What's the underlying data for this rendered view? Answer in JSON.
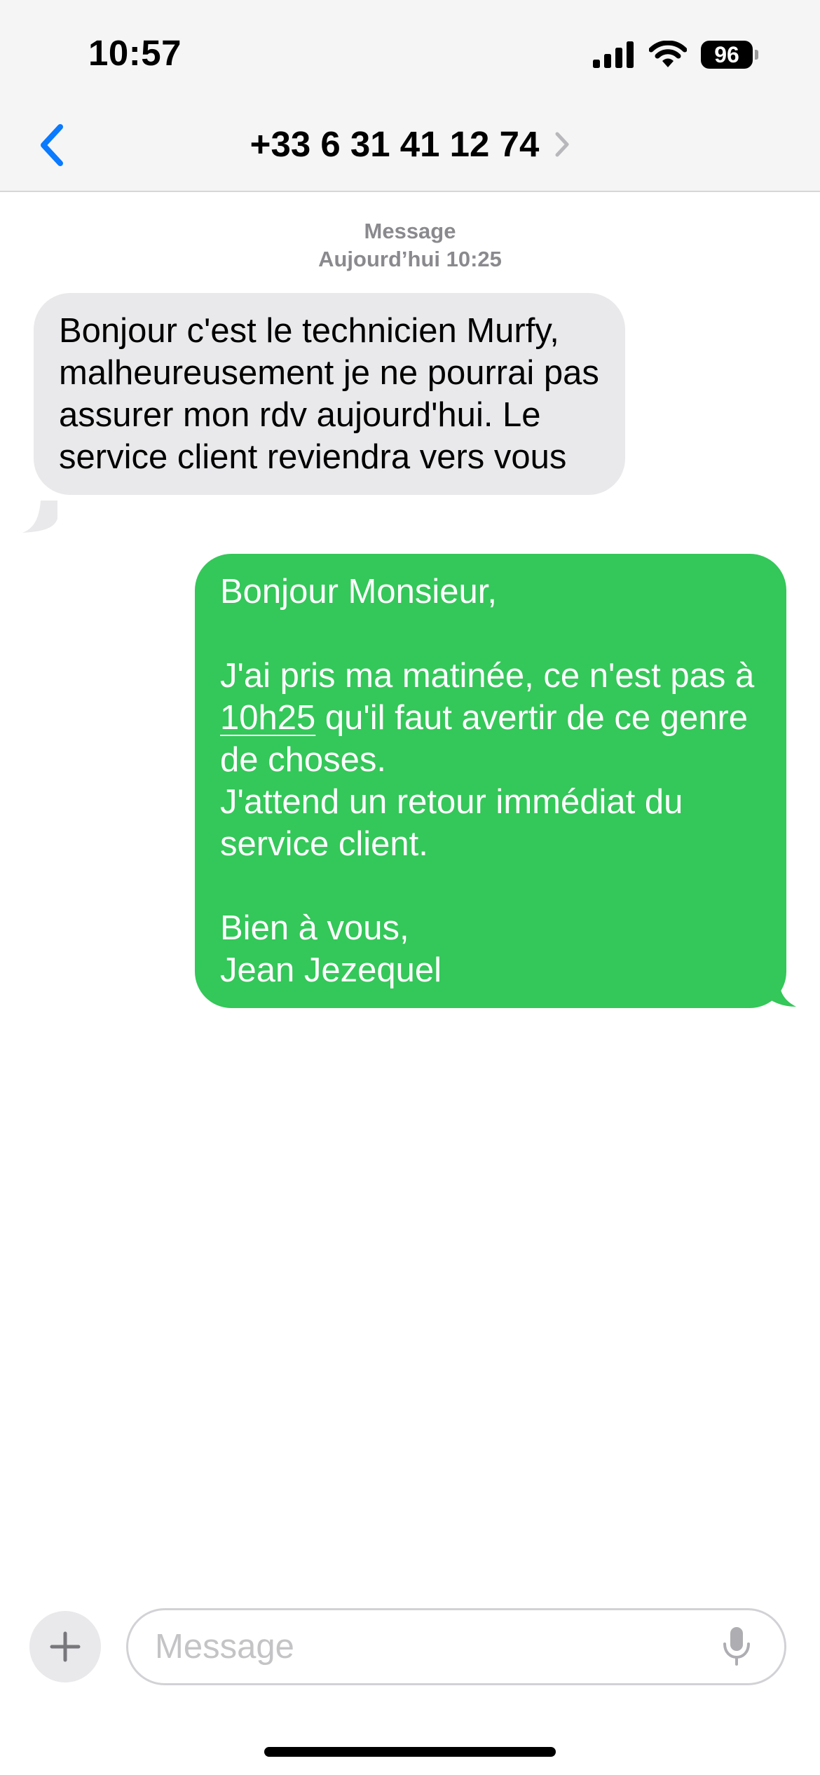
{
  "status_bar": {
    "time": "10:57",
    "battery": "96",
    "icons": [
      "cellular-signal-icon",
      "wifi-icon",
      "battery-icon"
    ]
  },
  "nav": {
    "back_icon": "chevron-left-icon",
    "contact": "+33 6 31 41 12 74",
    "details_icon": "chevron-right-icon"
  },
  "conversation": {
    "service": "Message",
    "timestamp": "Aujourd’hui 10:25",
    "incoming": {
      "text": "Bonjour c'est le technicien Murfy, malheureusement je ne pourrai pas assurer mon rdv aujourd'hui. Le service client reviendra vers vous"
    },
    "outgoing": {
      "part1": "Bonjour Monsieur,\n\nJ'ai pris ma matinée, ce n'est pas à ",
      "link": "10h25",
      "part2": " qu'il faut avertir de ce genre de choses.\nJ'attend un retour immédiat du service client.\n\nBien à vous,\nJean Jezequel"
    }
  },
  "composer": {
    "plus_icon": "plus-icon",
    "placeholder": "Message",
    "value": "",
    "mic_icon": "microphone-icon"
  },
  "colors": {
    "accent_blue": "#0a7aff",
    "outgoing_bubble": "#34c759",
    "incoming_bubble": "#e9e9eb",
    "meta_gray": "#8a8a8e"
  }
}
